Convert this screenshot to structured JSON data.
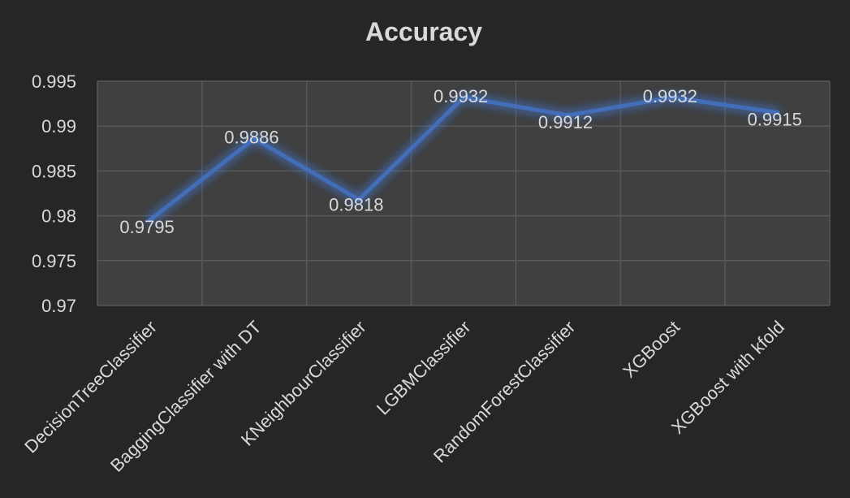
{
  "chart_data": {
    "type": "line",
    "title": "Accuracy",
    "xlabel": "",
    "ylabel": "",
    "categories": [
      "DecisionTreeClassifier",
      "BaggingClassifier with DT",
      "KNeighbourClassifier",
      "LGBMClassifier",
      "RandomForestClassifier",
      "XGBoost",
      "XGBoost with kfold"
    ],
    "series": [
      {
        "values": [
          0.9795,
          0.9886,
          0.9818,
          0.9932,
          0.9912,
          0.9932,
          0.9915
        ],
        "data_labels": [
          "0.9795",
          "0.9886",
          "0.9818",
          "0.9932",
          "0.9912",
          "0.9932",
          "0.9915"
        ]
      }
    ],
    "ylim": [
      0.97,
      0.995
    ],
    "y_ticks": [
      0.97,
      0.975,
      0.98,
      0.985,
      0.99,
      0.995
    ],
    "y_tick_labels": [
      "0.97",
      "0.975",
      "0.98",
      "0.985",
      "0.99",
      "0.995"
    ],
    "grid": true,
    "legend": "none",
    "colors": {
      "background": "#262626",
      "plot_area": "#404040",
      "gridline": "#595959",
      "line": "#4472c4",
      "glow": "#4472c4",
      "text": "#d9d9d9"
    }
  }
}
